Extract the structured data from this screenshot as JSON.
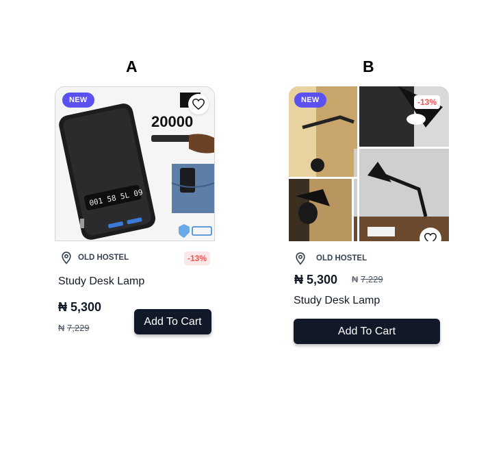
{
  "variants": {
    "a": {
      "label": "A",
      "badge_new": "NEW",
      "location": "OLD HOSTEL",
      "discount": "-13%",
      "title": "Study Desk Lamp",
      "currency": "₦",
      "price": "5,300",
      "old_price": "7,229",
      "cta": "Add To Cart",
      "image_text": "20000"
    },
    "b": {
      "label": "B",
      "badge_new": "NEW",
      "location": "OLD HOSTEL",
      "discount": "-13%",
      "title": "Study Desk Lamp",
      "currency": "₦",
      "price": "5,300",
      "old_price": "7,229",
      "cta": "Add To Cart"
    }
  },
  "colors": {
    "badge": "#5b50f0",
    "button": "#111827",
    "discount_text": "#f05252",
    "discount_bg": "#fde8e8"
  },
  "icons": [
    "heart-icon",
    "location-pin-icon"
  ]
}
